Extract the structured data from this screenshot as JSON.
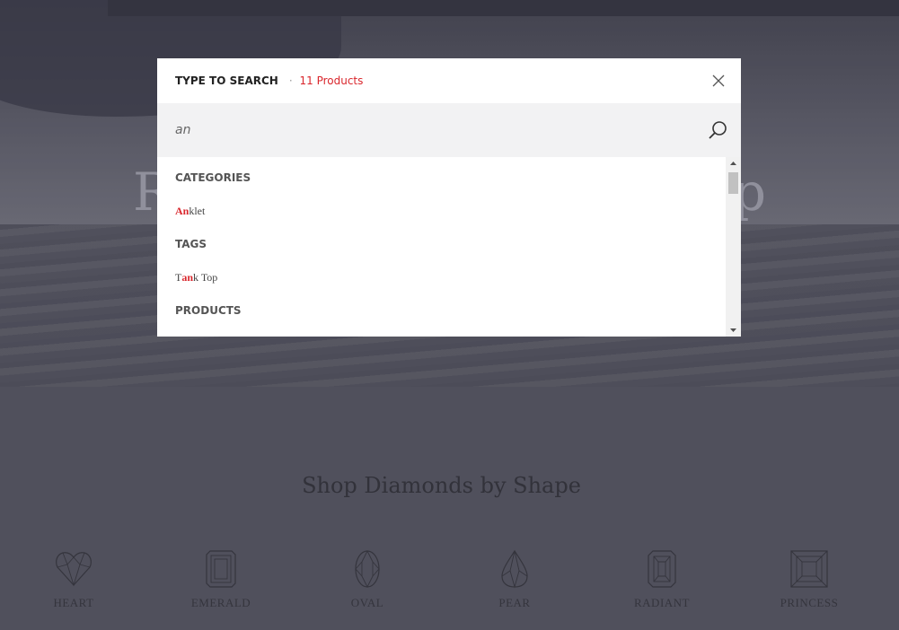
{
  "hero": {
    "title_left": "R",
    "title_right": "p"
  },
  "search_modal": {
    "title": "TYPE TO SEARCH",
    "separator": "·",
    "count": "11 Products",
    "query": "an",
    "groups": {
      "categories": {
        "title": "CATEGORIES",
        "items": [
          {
            "pre": "",
            "match": "An",
            "post": "klet"
          }
        ]
      },
      "tags": {
        "title": "TAGS",
        "items": [
          {
            "pre": "T",
            "match": "an",
            "post": "k Top"
          }
        ]
      },
      "products": {
        "title": "PRODUCTS"
      }
    }
  },
  "shapes_section": {
    "title": "Shop Diamonds by Shape",
    "shapes": [
      {
        "label": "HEART",
        "icon": "heart-diamond-icon"
      },
      {
        "label": "EMERALD",
        "icon": "emerald-diamond-icon"
      },
      {
        "label": "OVAL",
        "icon": "oval-diamond-icon"
      },
      {
        "label": "PEAR",
        "icon": "pear-diamond-icon"
      },
      {
        "label": "RADIANT",
        "icon": "radiant-diamond-icon"
      },
      {
        "label": "PRINCESS",
        "icon": "princess-diamond-icon"
      }
    ]
  },
  "colors": {
    "accent": "#d9262c",
    "modal_bg": "#ffffff",
    "search_bg": "#f2f2f3"
  }
}
